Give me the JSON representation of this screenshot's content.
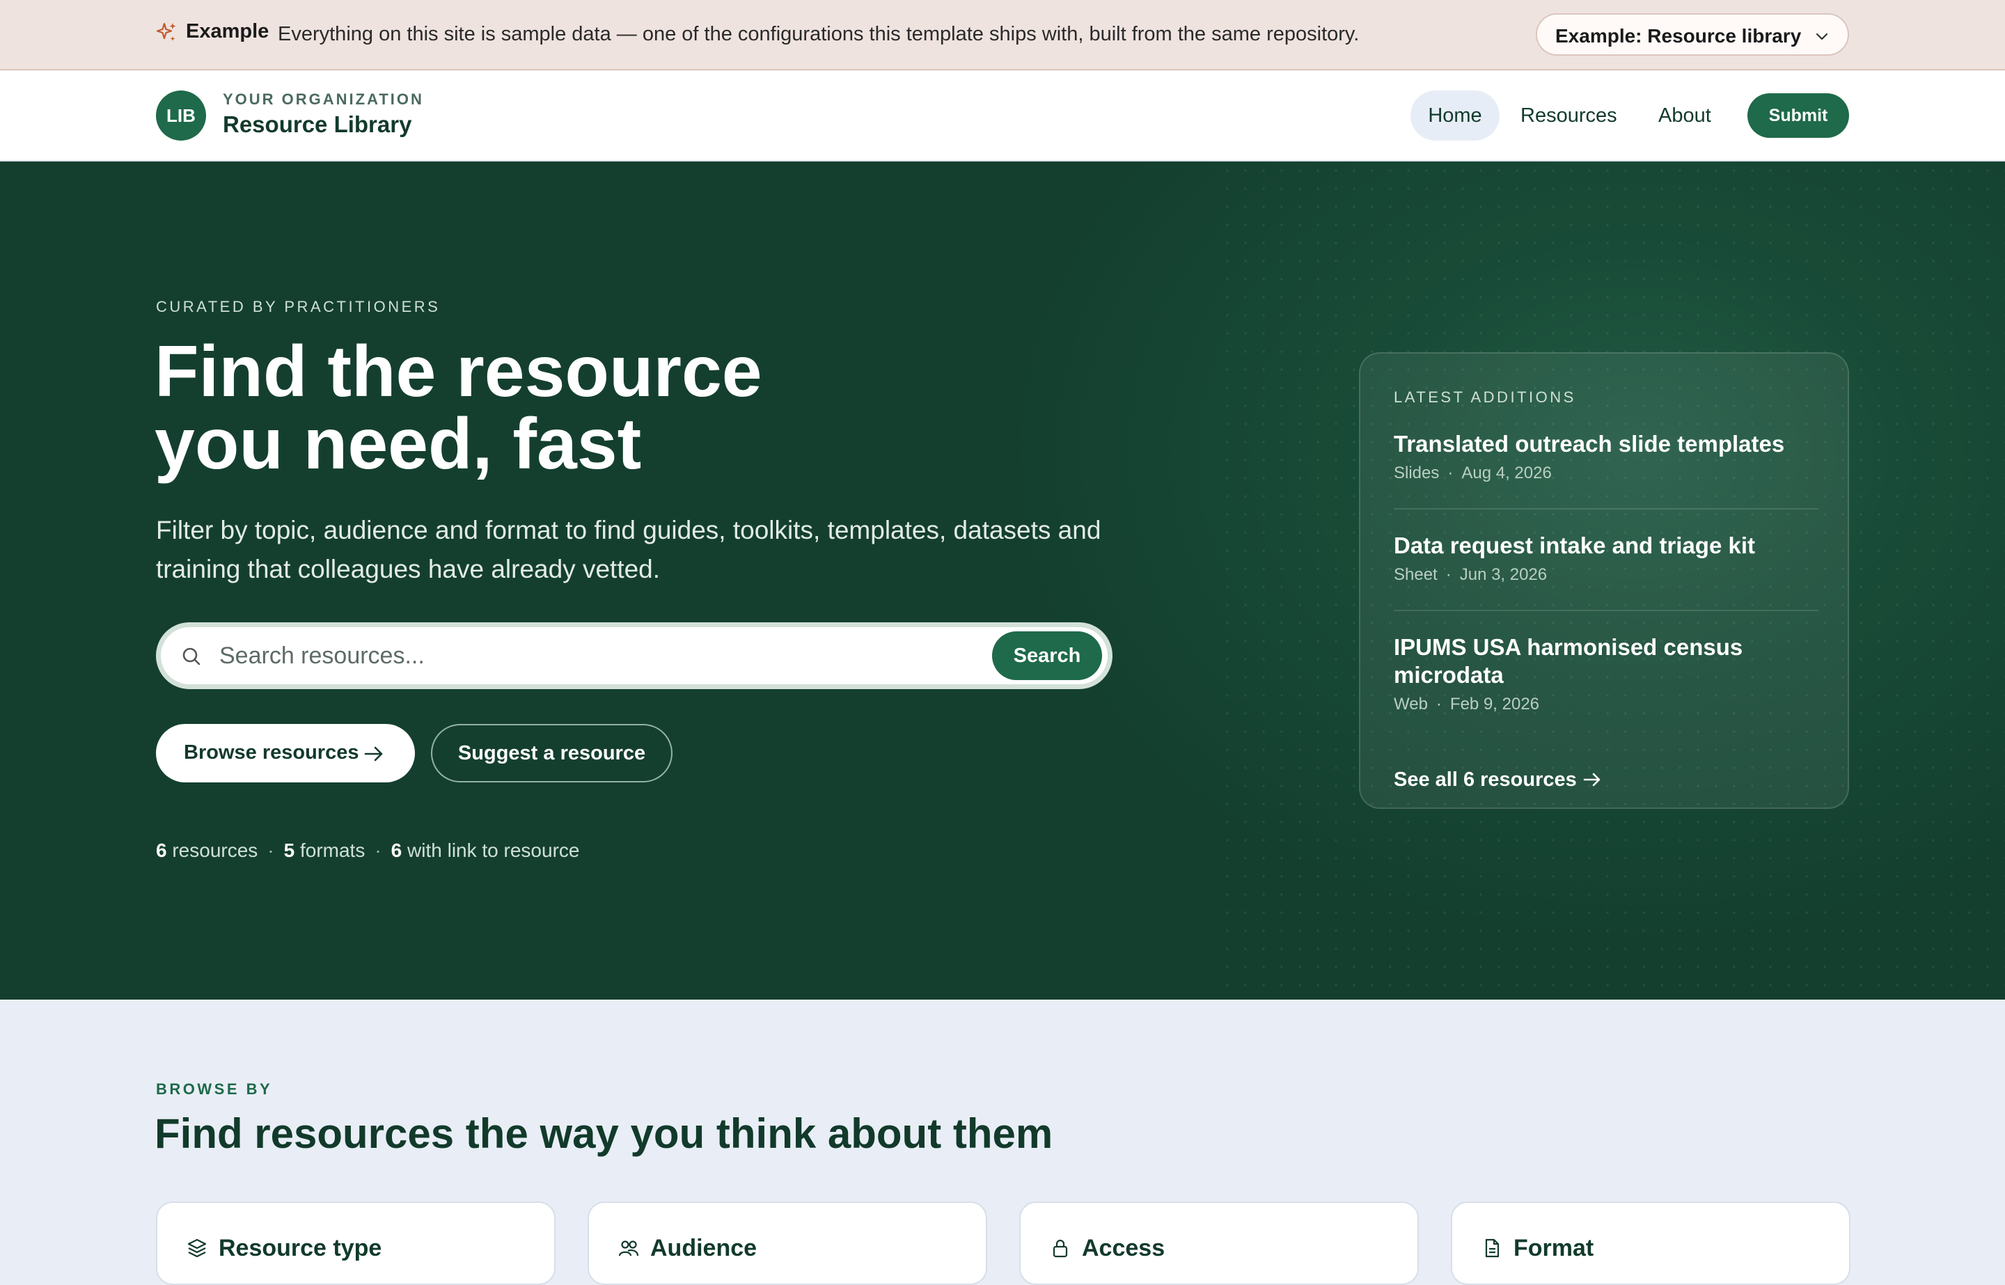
{
  "banner": {
    "tag": "Example",
    "message": "Everything on this site is sample data — one of the configurations this template ships with, built from the same repository.",
    "switcher_label": "Example: Resource library",
    "accent_color": "#c0582e"
  },
  "header": {
    "logo_text": "LIB",
    "org_name": "YOUR ORGANIZATION",
    "library_name": "Resource Library",
    "nav": {
      "home": "Home",
      "resources": "Resources",
      "about": "About"
    },
    "submit_label": "Submit"
  },
  "hero": {
    "eyebrow": "CURATED BY PRACTITIONERS",
    "title_line1": "Find the resource",
    "title_line2": "you need, fast",
    "subtitle": "Filter by topic, audience and format to find guides, toolkits, templates, datasets and training that colleagues have already vetted.",
    "search": {
      "placeholder": "Search resources...",
      "button_label": "Search"
    },
    "browse_label": "Browse resources",
    "suggest_label": "Suggest a resource",
    "stats": [
      {
        "value": "6",
        "label": " resources"
      },
      {
        "value": "5",
        "label": " formats"
      },
      {
        "value": "6",
        "label": " with link to resource"
      }
    ]
  },
  "latest": {
    "label": "LATEST ADDITIONS",
    "items": [
      {
        "title": "Translated outreach slide templates",
        "format": "Slides",
        "date": "Aug 4, 2026"
      },
      {
        "title": "Data request intake and triage kit",
        "format": "Sheet",
        "date": "Jun 3, 2026"
      },
      {
        "title": "IPUMS USA harmonised census microdata",
        "format": "Web",
        "date": "Feb 9, 2026"
      }
    ],
    "see_all_label": "See all 6 resources"
  },
  "browse_by": {
    "eyebrow": "BROWSE BY",
    "title": "Find resources the way you think about them",
    "cards": [
      {
        "label": "Resource type",
        "icon": "layers-icon"
      },
      {
        "label": "Audience",
        "icon": "people-icon"
      },
      {
        "label": "Access",
        "icon": "lock-icon"
      },
      {
        "label": "Format",
        "icon": "document-icon"
      }
    ]
  },
  "colors": {
    "brand": "#1e6a4a",
    "hero_bg": "#184b37",
    "page_bg": "#e9eef6"
  }
}
